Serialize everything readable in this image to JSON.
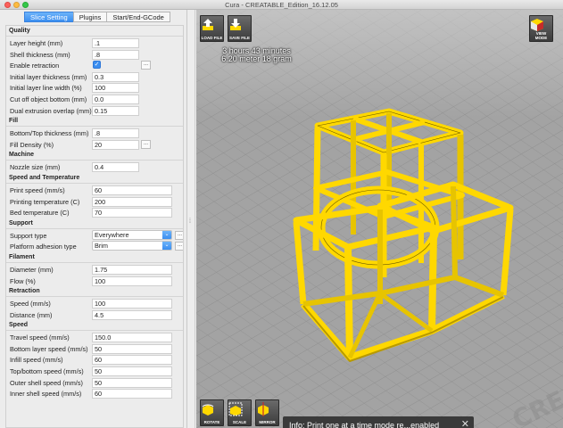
{
  "window": {
    "title": "Cura - CREATABLE_Edition_16.12.05"
  },
  "tabs": [
    {
      "label": "Slice Setting",
      "active": true
    },
    {
      "label": "Plugins",
      "active": false
    },
    {
      "label": "Start/End-GCode",
      "active": false
    }
  ],
  "sections": {
    "quality": "Quality",
    "fill": "Fill",
    "machine": "Machine",
    "speed_temp": "Speed and Temperature",
    "support": "Support",
    "filament": "Filament",
    "retraction": "Retraction",
    "speed": "Speed"
  },
  "settings": {
    "layer_height": {
      "label": "Layer height (mm)",
      "value": ".1"
    },
    "shell_thickness": {
      "label": "Shell thickness (mm)",
      "value": ".8"
    },
    "enable_retraction": {
      "label": "Enable retraction",
      "checked": true
    },
    "initial_layer_thickness": {
      "label": "Initial layer thickness (mm)",
      "value": "0.3"
    },
    "initial_layer_line_width": {
      "label": "Initial layer line width (%)",
      "value": "100"
    },
    "cut_off_bottom": {
      "label": "Cut off object bottom (mm)",
      "value": "0.0"
    },
    "dual_extrusion_overlap": {
      "label": "Dual extrusion overlap (mm)",
      "value": "0.15"
    },
    "bottom_top_thickness": {
      "label": "Bottom/Top thickness (mm)",
      "value": ".8"
    },
    "fill_density": {
      "label": "Fill Density (%)",
      "value": "20"
    },
    "nozzle_size": {
      "label": "Nozzle size (mm)",
      "value": "0.4"
    },
    "print_speed": {
      "label": "Print speed (mm/s)",
      "value": "60"
    },
    "printing_temperature": {
      "label": "Printing temperature (C)",
      "value": "200"
    },
    "bed_temperature": {
      "label": "Bed temperature (C)",
      "value": "70"
    },
    "support_type": {
      "label": "Support type",
      "value": "Everywhere"
    },
    "platform_adhesion": {
      "label": "Platform adhesion type",
      "value": "Brim"
    },
    "diameter": {
      "label": "Diameter (mm)",
      "value": "1.75"
    },
    "flow": {
      "label": "Flow (%)",
      "value": "100"
    },
    "retraction_speed": {
      "label": "Speed (mm/s)",
      "value": "100"
    },
    "retraction_distance": {
      "label": "Distance (mm)",
      "value": "4.5"
    },
    "travel_speed": {
      "label": "Travel speed (mm/s)",
      "value": "150.0"
    },
    "bottom_layer_speed": {
      "label": "Bottom layer speed (mm/s)",
      "value": "50"
    },
    "infill_speed": {
      "label": "Infill speed (mm/s)",
      "value": "60"
    },
    "top_bottom_speed": {
      "label": "Top/bottom speed (mm/s)",
      "value": "50"
    },
    "outer_shell_speed": {
      "label": "Outer shell speed (mm/s)",
      "value": "50"
    },
    "inner_shell_speed": {
      "label": "Inner shell speed (mm/s)",
      "value": "60"
    }
  },
  "more_button": "...",
  "toolbar": {
    "load_file": "LOAD FILE",
    "save_file": "SAVE FILE",
    "view_mode": "VIEW MODE",
    "rotate": "ROTATE",
    "scale": "SCALE",
    "mirror": "MIRROR"
  },
  "print_info": {
    "time": "3 hours 43 minutes",
    "material": "6.20 meter 18 gram"
  },
  "toast": {
    "message": "Info: Print one at a time mode re...enabled",
    "close": "✕"
  },
  "colors": {
    "model": "#ffd800",
    "accent": "#3b8ef0",
    "floor": "#a3a3a3"
  }
}
